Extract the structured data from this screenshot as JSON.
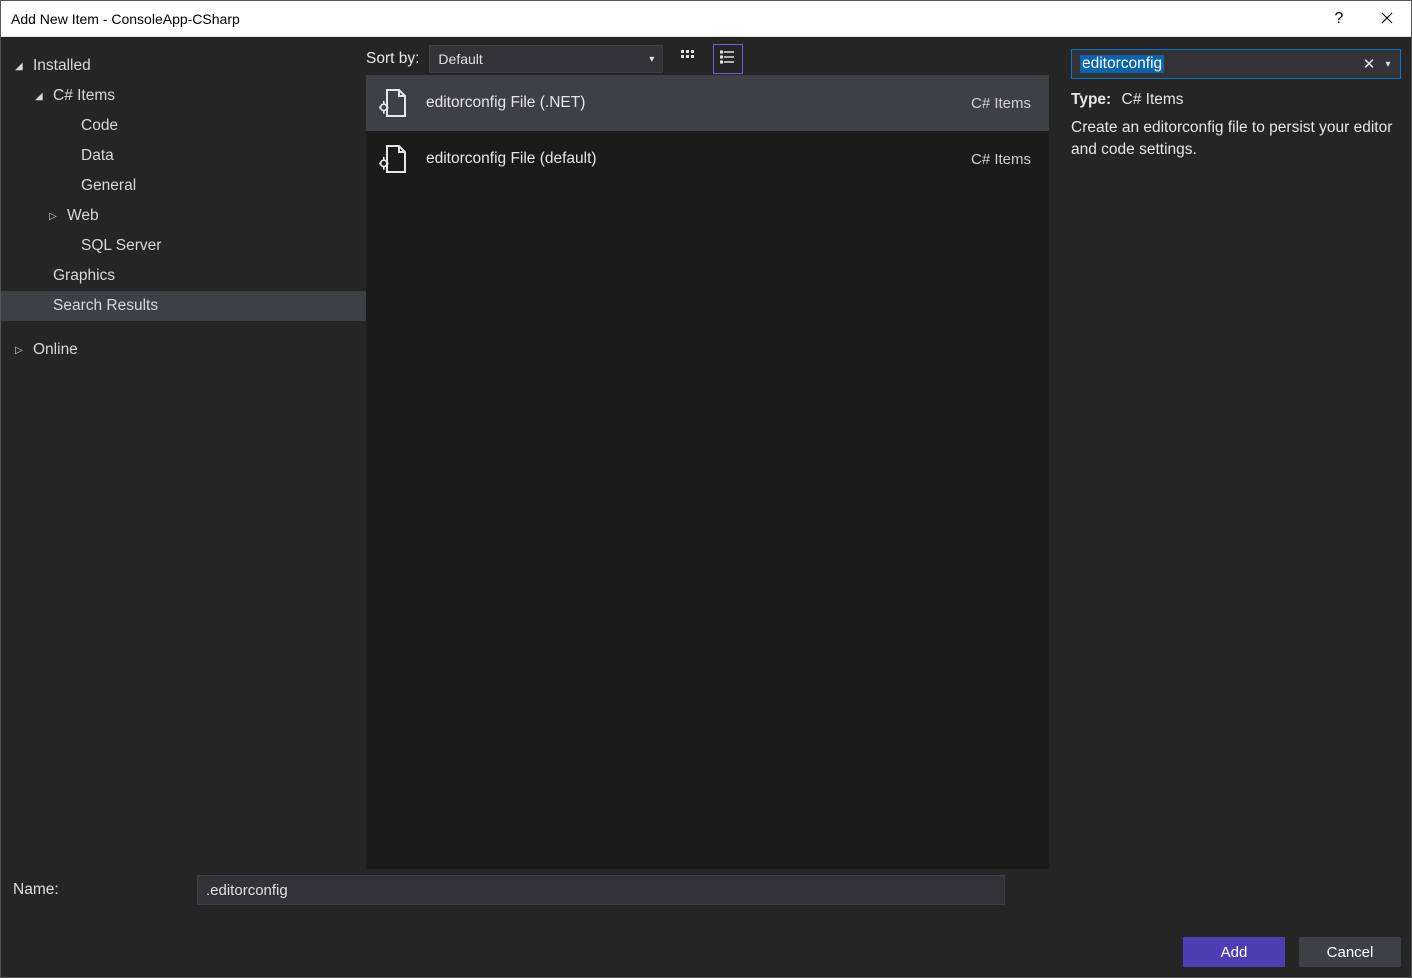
{
  "title": "Add New Item - ConsoleApp-CSharp",
  "sidebar": {
    "items": [
      {
        "label": "Installed",
        "expanded": true
      },
      {
        "label": "C# Items",
        "expanded": true
      },
      {
        "label": "Code"
      },
      {
        "label": "Data"
      },
      {
        "label": "General"
      },
      {
        "label": "Web",
        "hasChildren": true
      },
      {
        "label": "SQL Server"
      },
      {
        "label": "Graphics"
      },
      {
        "label": "Search Results",
        "selected": true
      },
      {
        "label": "Online",
        "hasChildren": true
      }
    ]
  },
  "toolbar": {
    "sort_label": "Sort by:",
    "sort_value": "Default"
  },
  "templates": [
    {
      "name": "editorconfig File (.NET)",
      "category": "C# Items",
      "selected": true
    },
    {
      "name": "editorconfig File (default)",
      "category": "C# Items"
    }
  ],
  "search": {
    "value": "editorconfig"
  },
  "info": {
    "type_label": "Type:",
    "type_value": "C# Items",
    "description": "Create an editorconfig file to persist your editor and code settings."
  },
  "footer": {
    "name_label": "Name:",
    "name_value": ".editorconfig",
    "add_label": "Add",
    "cancel_label": "Cancel"
  }
}
